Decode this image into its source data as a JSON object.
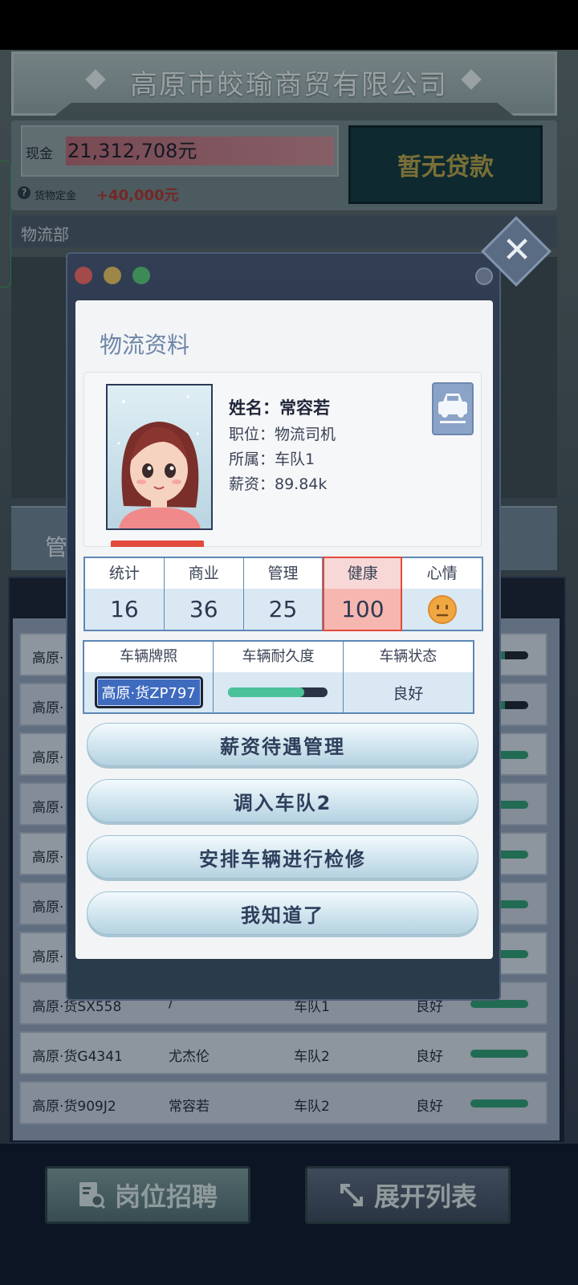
{
  "company": {
    "name": "高原市皎瑜商贸有限公司"
  },
  "finance": {
    "cash_label": "现金",
    "cash_value": "21,312,708元",
    "loan_button": "暂无贷款",
    "deposit_label": "货物定金",
    "deposit_value": "+40,000元",
    "help_glyph": "?"
  },
  "department": {
    "label": "物流部"
  },
  "background": {
    "mgmt_partial": "管"
  },
  "driver_list": [
    {
      "plate": "高原·货SX558",
      "driver": "/",
      "team": "车队1",
      "status": "良好"
    },
    {
      "plate": "高原·货G4341",
      "driver": "尤杰伦",
      "team": "车队2",
      "status": "良好"
    },
    {
      "plate": "高原·货909J2",
      "driver": "常容若",
      "team": "车队2",
      "status": "良好"
    }
  ],
  "partial_rows": [
    "高原·",
    "高原·",
    "高原·",
    "高原·",
    "高原·",
    "高原·",
    "高原·"
  ],
  "bottom": {
    "recruit": "岗位招聘",
    "expand": "展开列表"
  },
  "dialog": {
    "title": "物流资料",
    "close_glyph": "✕",
    "profile": {
      "name_line": "姓名：常容若",
      "position_line": "职位：物流司机",
      "team_line": "所属：车队1",
      "salary_line": "薪资：89.84k"
    },
    "stats": [
      {
        "label": "统计",
        "value": "16"
      },
      {
        "label": "商业",
        "value": "36"
      },
      {
        "label": "管理",
        "value": "25"
      },
      {
        "label": "健康",
        "value": "100"
      },
      {
        "label": "心情",
        "value": ""
      }
    ],
    "vehicle": {
      "plate_label": "车辆牌照",
      "plate_value": "高原·货ZP797",
      "durability_label": "车辆耐久度",
      "durability": 0.76,
      "status_label": "车辆状态",
      "status_value": "良好"
    },
    "buttons": {
      "salary": "薪资待遇管理",
      "transfer": "调入车队2",
      "repair": "安排车辆进行检修",
      "ok": "我知道了"
    }
  },
  "colors": {
    "accent_red": "#e24a3b",
    "table_border": "#5d87b5",
    "durability_green": "#4cc29a",
    "mood_face": "#f0a742"
  },
  "icons": [
    "help-icon",
    "license-icon",
    "mood-face-icon",
    "close-icon",
    "recruit-icon",
    "expand-icon"
  ]
}
